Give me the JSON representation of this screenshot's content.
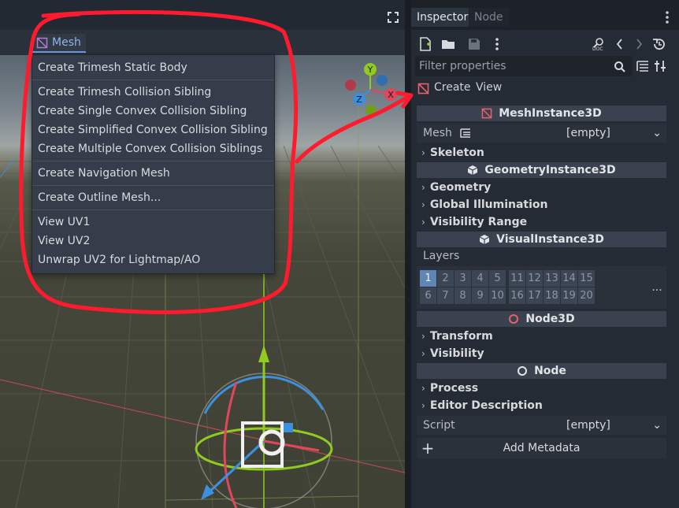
{
  "viewport": {
    "mesh_menu_label": "Mesh",
    "dropdown_items": [
      [
        "Create Trimesh Static Body"
      ],
      [
        "Create Trimesh Collision Sibling",
        "Create Single Convex Collision Sibling",
        "Create Simplified Convex Collision Sibling",
        "Create Multiple Convex Collision Siblings"
      ],
      [
        "Create Navigation Mesh"
      ],
      [
        "Create Outline Mesh..."
      ],
      [
        "View UV1",
        "View UV2",
        "Unwrap UV2 for Lightmap/AO"
      ]
    ],
    "gizmo_axes": {
      "y": "Y",
      "z": "Z",
      "x": "X"
    }
  },
  "inspector": {
    "tabs": [
      "Inspector",
      "Node"
    ],
    "filter_placeholder": "Filter properties",
    "create_label": "Create",
    "view_label": "View",
    "sections": {
      "mesh_instance": "MeshInstance3D",
      "geometry_instance": "GeometryInstance3D",
      "visual_instance": "VisualInstance3D",
      "node3d": "Node3D",
      "node": "Node"
    },
    "mesh_prop": {
      "name": "Mesh",
      "value": "[empty]"
    },
    "groups": {
      "skeleton": "Skeleton",
      "geometry": "Geometry",
      "global_illumination": "Global Illumination",
      "visibility_range": "Visibility Range",
      "transform": "Transform",
      "visibility": "Visibility",
      "process": "Process",
      "editor_description": "Editor Description"
    },
    "layers_label": "Layers",
    "layers": [
      "1",
      "2",
      "3",
      "4",
      "5",
      "11",
      "12",
      "13",
      "14",
      "15",
      "6",
      "7",
      "8",
      "9",
      "10",
      "16",
      "17",
      "18",
      "19",
      "20"
    ],
    "active_layer": "1",
    "layers_more": "...",
    "script_prop": {
      "name": "Script",
      "value": "[empty]"
    },
    "add_metadata": "Add Metadata",
    "add_icon": "+",
    "chevron": "›",
    "dropdown_arrow": "⌄"
  },
  "colors": {
    "accent": "#699ce8",
    "annotation_red": "#ff1a2e",
    "mesh_icon_red": "#e8606e",
    "axis_x": "#e0475a",
    "axis_y": "#8fcc1f",
    "axis_z": "#3d8fe0"
  }
}
